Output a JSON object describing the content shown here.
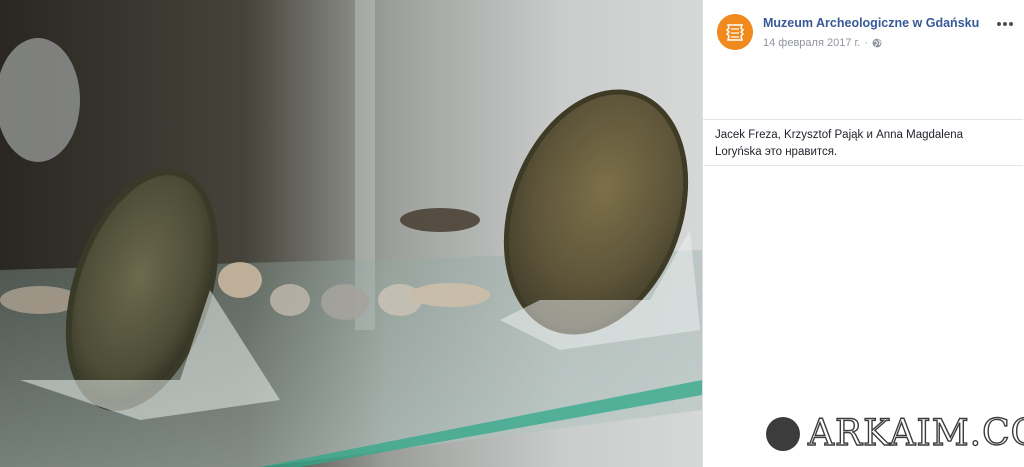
{
  "post": {
    "page_name": "Muzeum Archeologiczne w Gdańsku",
    "date": "14 февраля 2017 г.",
    "separator": "·",
    "likes_text": "Jacek Freza, Krzysztof Pająk и Anna Magdalena Loryńska это нравится."
  },
  "icons": {
    "avatar": "museum-logo-icon",
    "audience": "globe-icon",
    "options": "more-options-icon"
  },
  "colors": {
    "link": "#385898",
    "meta": "#90949c",
    "avatar_bg": "#f08a1e"
  },
  "watermark": {
    "text": "ARKAIM.CO"
  }
}
